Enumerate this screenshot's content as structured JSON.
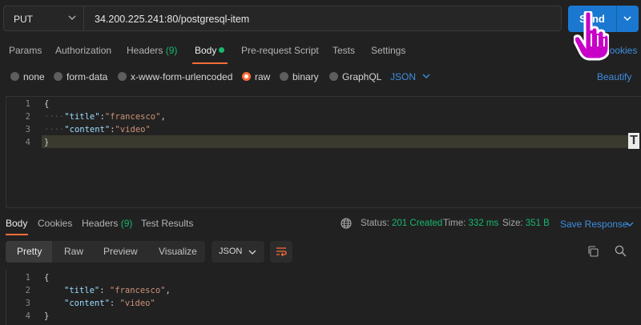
{
  "request": {
    "method": "PUT",
    "url": "34.200.225.241:80/postgresql-item",
    "send_label": "Send",
    "cookies_label": "Cookies"
  },
  "tabs": [
    {
      "label": "Params"
    },
    {
      "label": "Authorization"
    },
    {
      "label": "Headers",
      "count": "(9)"
    },
    {
      "label": "Body"
    },
    {
      "label": "Pre-request Script"
    },
    {
      "label": "Tests"
    },
    {
      "label": "Settings"
    }
  ],
  "body_types": [
    "none",
    "form-data",
    "x-www-form-urlencoded",
    "raw",
    "binary",
    "GraphQL"
  ],
  "body_format": "JSON",
  "beautify_label": "Beautify",
  "request_body": {
    "line_numbers": [
      "1",
      "2",
      "3",
      "4"
    ],
    "open": "{",
    "title_key": "\"title\"",
    "title_sep": ":",
    "title_value": "\"francesco\"",
    "title_comma": ",",
    "content_key": "\"content\"",
    "content_sep": ":",
    "content_value": "\"video\"",
    "close": "}",
    "indent_dots": "····"
  },
  "response_tabs": [
    {
      "label": "Body"
    },
    {
      "label": "Cookies"
    },
    {
      "label": "Headers",
      "count": "(9)"
    },
    {
      "label": "Test Results"
    }
  ],
  "response_status": {
    "status_label": "Status:",
    "status_value": "201 Created",
    "time_label": "Time:",
    "time_value": "332 ms",
    "size_label": "Size:",
    "size_value": "351 B",
    "save_label": "Save Response"
  },
  "view_modes": [
    "Pretty",
    "Raw",
    "Preview",
    "Visualize"
  ],
  "response_format": "JSON",
  "response_body": {
    "line_numbers": [
      "1",
      "2",
      "3",
      "4"
    ],
    "open": "{",
    "title_key": "\"title\"",
    "title_sep": ": ",
    "title_value": "\"francesco\"",
    "title_comma": ",",
    "content_key": "\"content\"",
    "content_sep": ": ",
    "content_value": "\"video\"",
    "close": "}"
  },
  "colors": {
    "accent_orange": "#ff6c37",
    "link_blue": "#3d8fe0",
    "send_blue": "#1b78d1",
    "success_green": "#16b86e",
    "cursor_magenta": "#d100d1"
  },
  "icons": [
    "chevron-down-icon",
    "globe-icon",
    "copy-icon",
    "search-icon",
    "wrap-lines-icon",
    "hand-pointer-icon"
  ]
}
